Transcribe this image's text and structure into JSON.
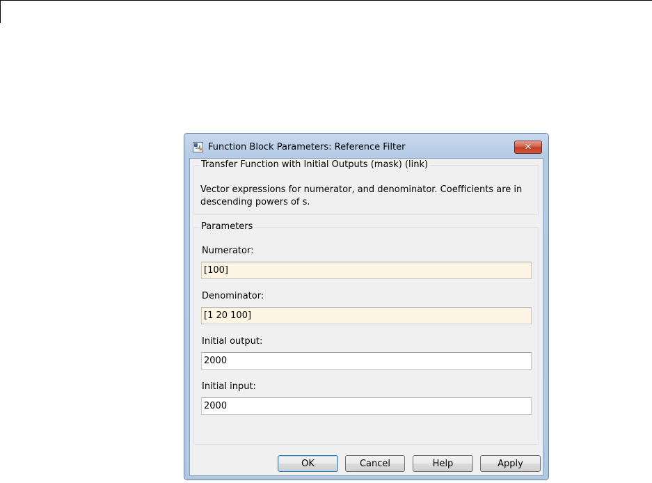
{
  "window": {
    "title": "Function Block Parameters: Reference Filter",
    "close_symbol": "✕"
  },
  "mask": {
    "heading": "Transfer Function with Initial Outputs (mask) (link)",
    "description": "Vector expressions for numerator, and denominator. Coefficients are in descending powers of s."
  },
  "parameters": {
    "heading": "Parameters",
    "fields": [
      {
        "label": "Numerator:",
        "value": "[100]"
      },
      {
        "label": "Denominator:",
        "value": "[1 20 100]"
      },
      {
        "label": "Initial output:",
        "value": "2000"
      },
      {
        "label": "Initial input:",
        "value": "2000"
      }
    ]
  },
  "buttons": {
    "ok": "OK",
    "cancel": "Cancel",
    "help": "Help",
    "apply": "Apply"
  },
  "colors": {
    "edited_field_bg": "#fdf4e3",
    "close_button": "#c94a2f",
    "dialog_frame": "#b9cfe7"
  },
  "icons": {
    "title": "simulink-block-icon",
    "close": "close-icon"
  }
}
